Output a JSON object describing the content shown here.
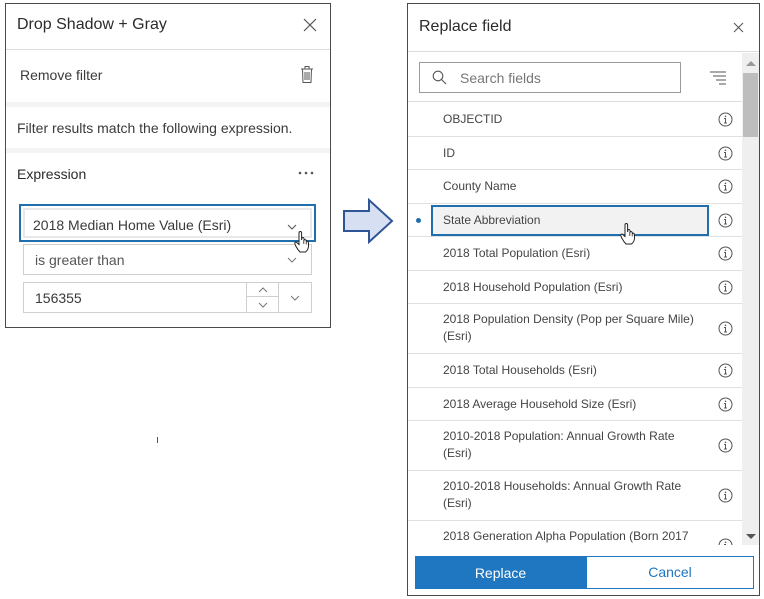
{
  "filter_panel": {
    "title": "Drop Shadow + Gray",
    "close_icon": "close-icon",
    "remove_filter_label": "Remove filter",
    "trash_icon": "trash-icon",
    "description": "Filter results match the following expression.",
    "expression": {
      "label": "Expression",
      "more_icon": "ellipsis-icon",
      "field_value": "2018 Median Home Value (Esri)",
      "operator_value": "is greater than",
      "value_input": "156355"
    }
  },
  "arrow": {
    "icon": "right-arrow-icon",
    "fill": "#d6e0f2",
    "stroke": "#2f5597"
  },
  "replace_panel": {
    "title": "Replace field",
    "close_icon": "close-icon",
    "search": {
      "placeholder": "Search fields",
      "value": ""
    },
    "sort_icon": "sort-icon",
    "fields": [
      {
        "label": "OBJECTID",
        "lines": 1,
        "selected": false
      },
      {
        "label": "ID",
        "lines": 1,
        "selected": false
      },
      {
        "label": "County Name",
        "lines": 1,
        "selected": false
      },
      {
        "label": "State Abbreviation",
        "lines": 1,
        "selected": true
      },
      {
        "label": "2018 Total Population (Esri)",
        "lines": 1,
        "selected": false
      },
      {
        "label": "2018 Household Population (Esri)",
        "lines": 1,
        "selected": false
      },
      {
        "label": "2018 Population Density (Pop per Square Mile) (Esri)",
        "lines": 2,
        "selected": false
      },
      {
        "label": "2018 Total Households (Esri)",
        "lines": 1,
        "selected": false
      },
      {
        "label": "2018 Average Household Size (Esri)",
        "lines": 1,
        "selected": false
      },
      {
        "label": "2010-2018 Population: Annual Growth Rate (Esri)",
        "lines": 2,
        "selected": false
      },
      {
        "label": "2010-2018 Households: Annual Growth Rate (Esri)",
        "lines": 2,
        "selected": false
      },
      {
        "label": "2018 Generation Alpha Population (Born 2017",
        "lines": 2,
        "selected": false
      }
    ],
    "replace_label": "Replace",
    "cancel_label": "Cancel"
  },
  "colors": {
    "accent": "#1f76c1",
    "focus_border": "#1f6fae",
    "panel_border": "#4a4a4a"
  }
}
